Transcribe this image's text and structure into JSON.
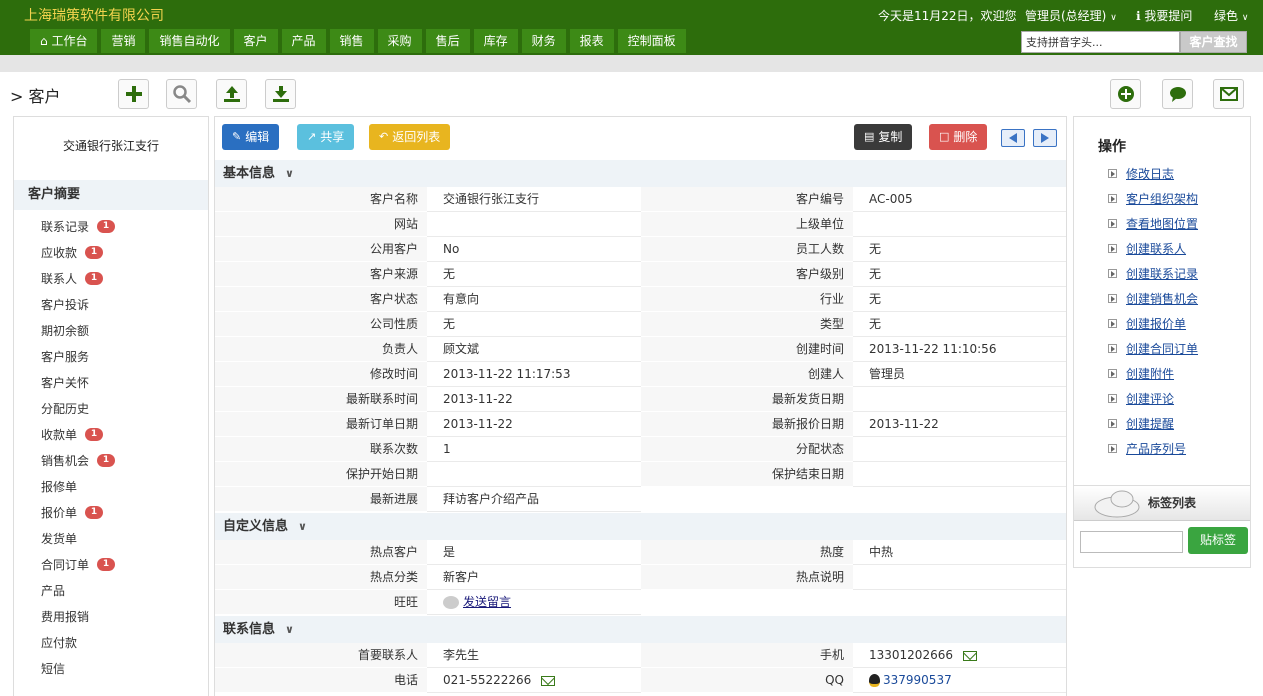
{
  "header": {
    "company": "上海瑞策软件有限公司",
    "greeting": "今天是11月22日，欢迎您",
    "user": "管理员(总经理)",
    "help": "我要提问",
    "theme": "绿色",
    "search_value": "支持拼音字头...",
    "search_button": "客户查找",
    "nav": [
      "工作台",
      "营销",
      "销售自动化",
      "客户",
      "产品",
      "销售",
      "采购",
      "售后",
      "库存",
      "财务",
      "报表",
      "控制面板"
    ]
  },
  "page": {
    "title": "> 客户"
  },
  "sidebar": {
    "customer_name": "交通银行张江支行",
    "summary_title": "客户摘要",
    "items": [
      {
        "label": "联系记录",
        "badge": "1"
      },
      {
        "label": "应收款",
        "badge": "1"
      },
      {
        "label": "联系人",
        "badge": "1"
      },
      {
        "label": "客户投诉",
        "badge": ""
      },
      {
        "label": "期初余额",
        "badge": ""
      },
      {
        "label": "客户服务",
        "badge": ""
      },
      {
        "label": "客户关怀",
        "badge": ""
      },
      {
        "label": "分配历史",
        "badge": ""
      },
      {
        "label": "收款单",
        "badge": "1"
      },
      {
        "label": "销售机会",
        "badge": "1"
      },
      {
        "label": "报修单",
        "badge": ""
      },
      {
        "label": "报价单",
        "badge": "1"
      },
      {
        "label": "发货单",
        "badge": ""
      },
      {
        "label": "合同订单",
        "badge": "1"
      },
      {
        "label": "产品",
        "badge": ""
      },
      {
        "label": "费用报销",
        "badge": ""
      },
      {
        "label": "应付款",
        "badge": ""
      },
      {
        "label": "短信",
        "badge": ""
      }
    ]
  },
  "actions": {
    "edit": "编辑",
    "share": "共享",
    "back": "返回列表",
    "copy": "复制",
    "delete": "删除"
  },
  "sections": {
    "basic": {
      "title": "基本信息",
      "rows": [
        [
          "客户名称",
          "交通银行张江支行",
          "客户编号",
          "AC-005"
        ],
        [
          "网站",
          "",
          "上级单位",
          ""
        ],
        [
          "公用客户",
          "No",
          "员工人数",
          "无"
        ],
        [
          "客户来源",
          "无",
          "客户级别",
          "无"
        ],
        [
          "客户状态",
          "有意向",
          "行业",
          "无"
        ],
        [
          "公司性质",
          "无",
          "类型",
          "无"
        ],
        [
          "负责人",
          "顾文斌",
          "创建时间",
          "2013-11-22 11:10:56"
        ],
        [
          "修改时间",
          "2013-11-22 11:17:53",
          "创建人",
          "管理员"
        ],
        [
          "最新联系时间",
          "2013-11-22",
          "最新发货日期",
          ""
        ],
        [
          "最新订单日期",
          "2013-11-22",
          "最新报价日期",
          "2013-11-22"
        ],
        [
          "联系次数",
          "1",
          "分配状态",
          ""
        ],
        [
          "保护开始日期",
          "",
          "保护结束日期",
          ""
        ]
      ],
      "last_label": "最新进展",
      "last_value": "拜访客户介绍产品"
    },
    "custom": {
      "title": "自定义信息",
      "rows": [
        [
          "热点客户",
          "是",
          "热度",
          "中热"
        ],
        [
          "热点分类",
          "新客户",
          "热点说明",
          ""
        ]
      ],
      "ww_label": "旺旺",
      "ww_link": "发送留言"
    },
    "contact": {
      "title": "联系信息",
      "primary_label": "首要联系人",
      "primary_value": "李先生",
      "mobile_label": "手机",
      "mobile_value": "13301202666",
      "phone_label": "电话",
      "phone_value": "021-55222266",
      "qq_label": "QQ",
      "qq_value": "337990537"
    }
  },
  "ops": {
    "title": "操作",
    "items": [
      "修改日志",
      "客户组织架构",
      "查看地图位置",
      "创建联系人",
      "创建联系记录",
      "创建销售机会",
      "创建报价单",
      "创建合同订单",
      "创建附件",
      "创建评论",
      "创建提醒",
      "产品序列号"
    ]
  },
  "tags": {
    "title": "标签列表",
    "button": "贴标签"
  }
}
